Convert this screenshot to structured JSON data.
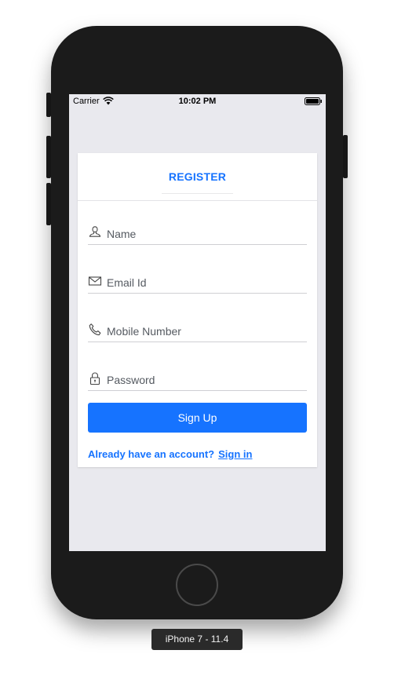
{
  "status_bar": {
    "carrier": "Carrier",
    "time": "10:02 PM",
    "wifi_icon": "wifi-icon",
    "battery_icon": "battery-icon"
  },
  "register_card": {
    "tab_label": "REGISTER",
    "fields": {
      "name": {
        "placeholder": "Name",
        "value": "",
        "icon": "person-icon"
      },
      "email": {
        "placeholder": "Email Id",
        "value": "",
        "icon": "envelope-icon"
      },
      "mobile": {
        "placeholder": "Mobile Number",
        "value": "",
        "icon": "phone-icon"
      },
      "password": {
        "placeholder": "Password",
        "value": "",
        "icon": "lock-icon"
      }
    },
    "signup_label": "Sign Up",
    "signin_prompt": "Already have an account?",
    "signin_link": "Sign in"
  },
  "device": {
    "label": "iPhone 7 - 11.4"
  },
  "colors": {
    "accent": "#1673ff",
    "screen_background": "#e9e9ee",
    "phone_body": "#1b1b1b",
    "card_background": "#ffffff"
  }
}
